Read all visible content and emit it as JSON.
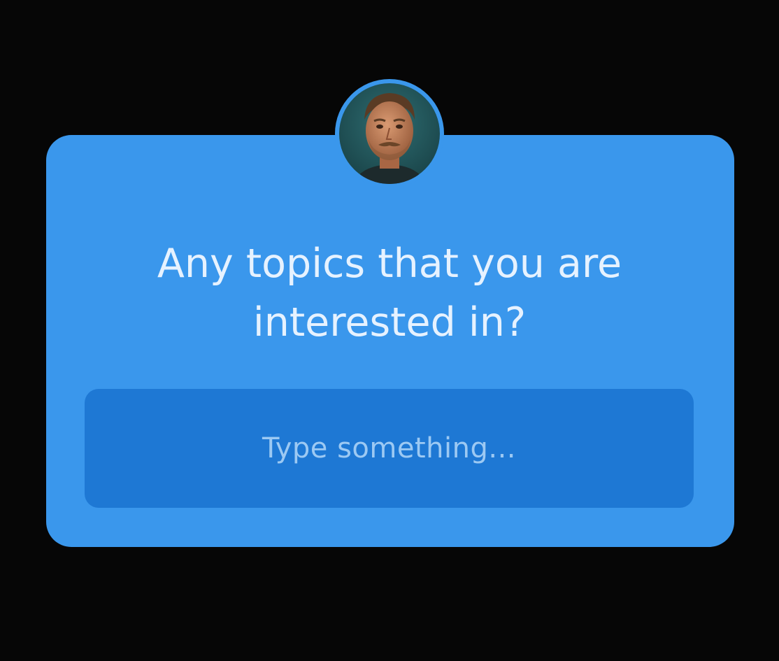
{
  "question": {
    "line1": "Any topics that you are",
    "line2": "interested in?"
  },
  "answer_field": {
    "placeholder": "Type something..."
  },
  "avatar": {
    "icon": "profile-photo"
  },
  "colors": {
    "background": "#060606",
    "card": "#3a97ec",
    "input": "#1e78d4",
    "question_text": "#e6f2ff",
    "placeholder_text": "#9cc9f3"
  }
}
